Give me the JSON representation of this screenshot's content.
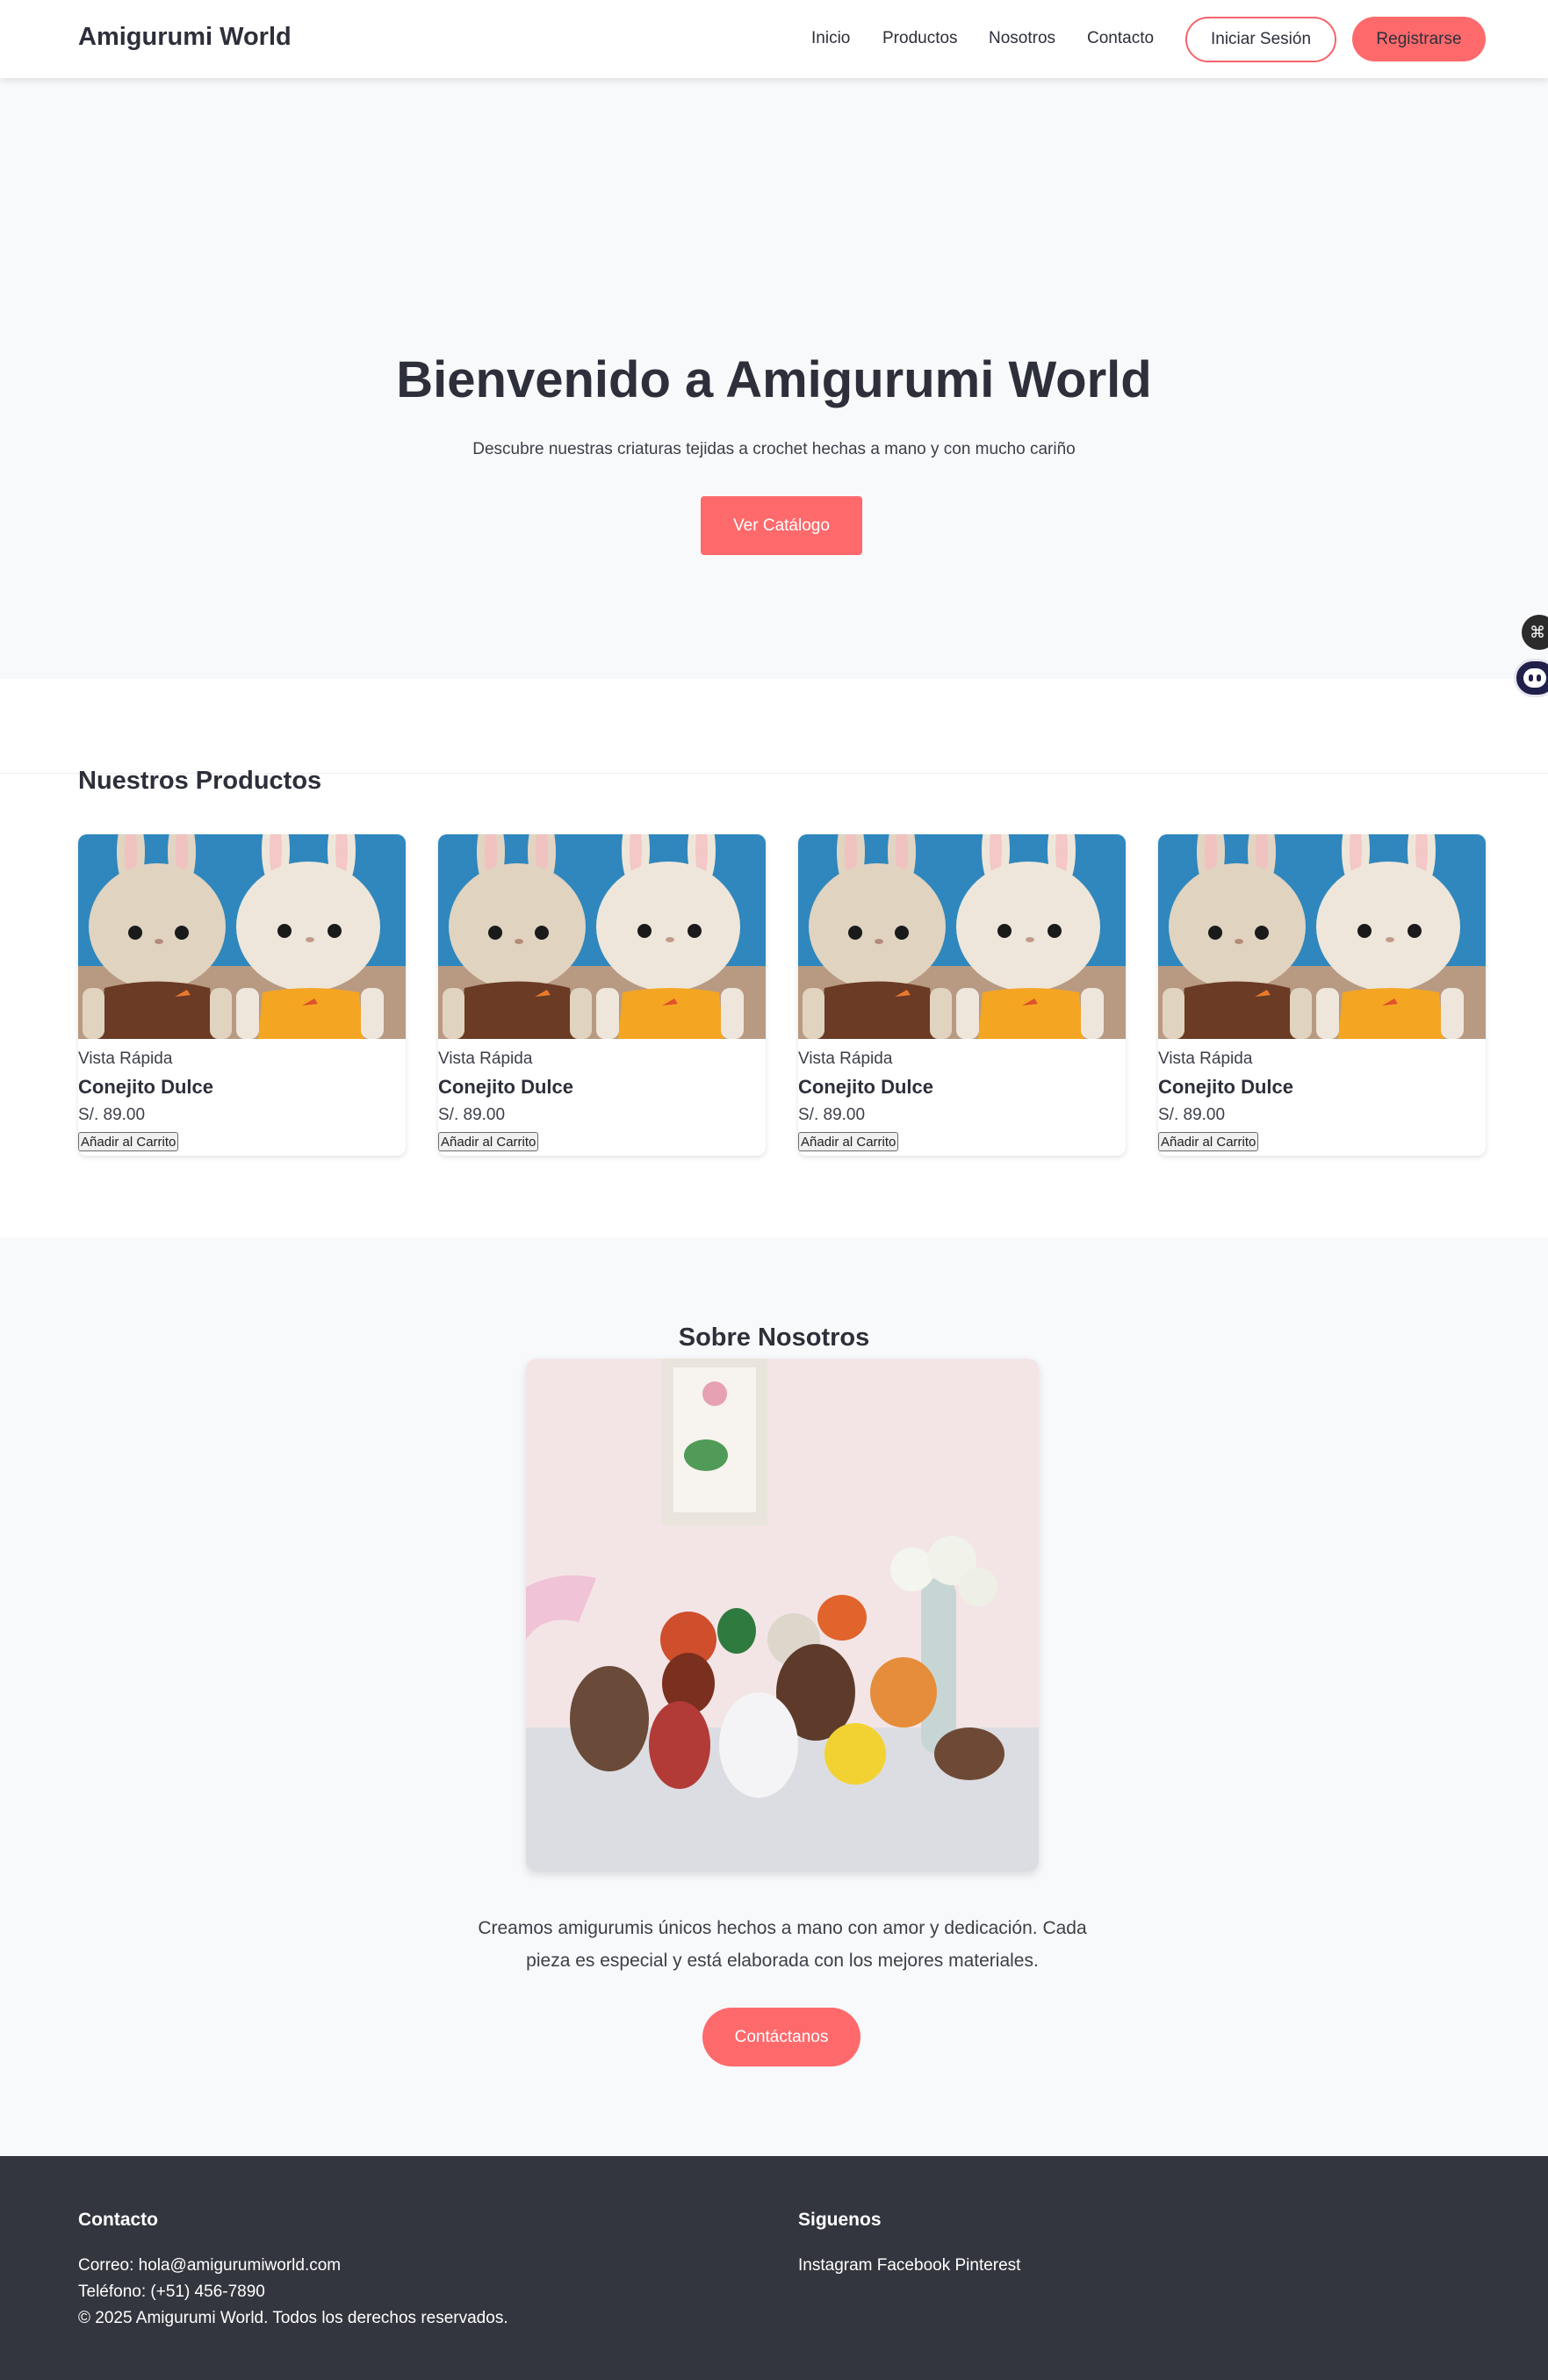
{
  "nav": {
    "brand": "Amigurumi World",
    "links": [
      "Inicio",
      "Productos",
      "Nosotros",
      "Contacto"
    ],
    "login": "Iniciar Sesión",
    "register": "Registrarse"
  },
  "hero": {
    "title": "Bienvenido a Amigurumi World",
    "subtitle": "Descubre nuestras criaturas tejidas a crochet hechas a mano y con mucho cariño",
    "cta": "Ver Catálogo"
  },
  "products": {
    "title": "Nuestros Productos",
    "items": [
      {
        "quick_view": "Vista Rápida",
        "name": "Conejito Dulce",
        "price": "S/. 89.00",
        "add_to_cart": "Añadir al Carrito"
      },
      {
        "quick_view": "Vista Rápida",
        "name": "Conejito Dulce",
        "price": "S/. 89.00",
        "add_to_cart": "Añadir al Carrito"
      },
      {
        "quick_view": "Vista Rápida",
        "name": "Conejito Dulce",
        "price": "S/. 89.00",
        "add_to_cart": "Añadir al Carrito"
      },
      {
        "quick_view": "Vista Rápida",
        "name": "Conejito Dulce",
        "price": "S/. 89.00",
        "add_to_cart": "Añadir al Carrito"
      }
    ]
  },
  "about": {
    "title": "Sobre Nosotros",
    "text": "Creamos amigurumis únicos hechos a mano con amor y dedicación. Cada pieza es especial y está elaborada con los mejores materiales.",
    "cta": "Contáctanos"
  },
  "footer": {
    "contact_title": "Contacto",
    "email": "Correo: hola@amigurumiworld.com",
    "phone": "Teléfono: (+51) 456-7890",
    "copyright": "© 2025 Amigurumi World. Todos los derechos reservados.",
    "social_title": "Siguenos",
    "social_links": "Instagram Facebook Pinterest"
  },
  "colors": {
    "accent": "#fe6a6c",
    "text": "#2d2f3a",
    "hero_bg": "#f8f9fb",
    "footer_bg": "#33363e"
  },
  "icons": {
    "fab_top": "command-icon",
    "fab_bottom": "chatbot-icon"
  }
}
